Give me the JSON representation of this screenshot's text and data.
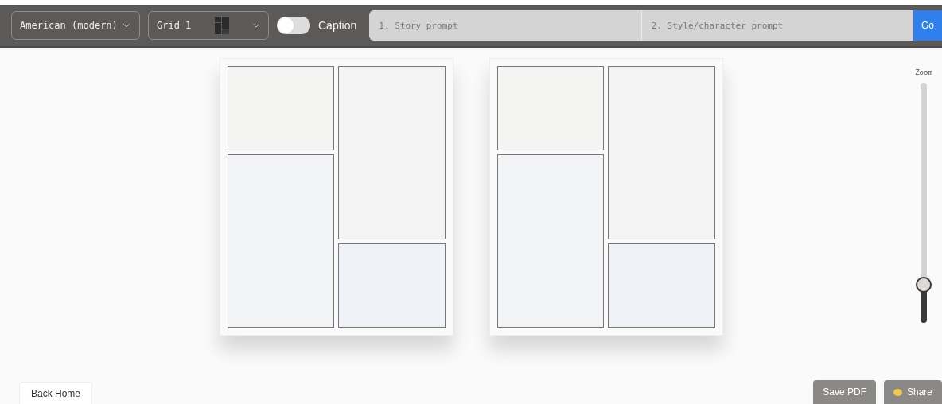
{
  "toolbar": {
    "style_select": {
      "value": "American (modern)"
    },
    "grid_select": {
      "value": "Grid 1"
    },
    "caption_toggle": {
      "label": "Caption",
      "on": false
    },
    "story_prompt": {
      "placeholder": "1. Story prompt"
    },
    "style_prompt": {
      "placeholder": "2. Style/character prompt"
    },
    "go_button": "Go"
  },
  "pages": [
    {
      "kind": "blank"
    },
    {
      "kind": "blank"
    }
  ],
  "zoom": {
    "label": "Zoom",
    "level": 0.16
  },
  "footer": {
    "back_button": "Back Home",
    "save_button": "Save PDF",
    "share_button": "Share"
  }
}
